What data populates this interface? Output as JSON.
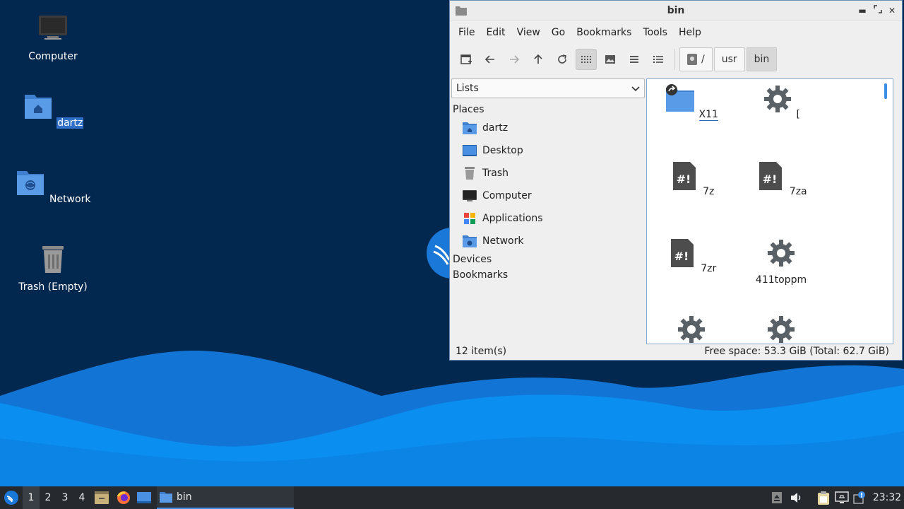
{
  "desktop": {
    "icons": [
      {
        "label": "Computer"
      },
      {
        "label": "dartz"
      },
      {
        "label": "Network"
      },
      {
        "label": "Trash (Empty)"
      }
    ]
  },
  "window": {
    "title": "bin",
    "menus": [
      "File",
      "Edit",
      "View",
      "Go",
      "Bookmarks",
      "Tools",
      "Help"
    ],
    "path": [
      "/",
      "usr",
      "bin"
    ],
    "side_mode": "Lists",
    "places_heading": "Places",
    "places": [
      {
        "label": "dartz",
        "icon": "home-folder-icon"
      },
      {
        "label": "Desktop",
        "icon": "desktop-icon"
      },
      {
        "label": "Trash",
        "icon": "trash-icon"
      },
      {
        "label": "Computer",
        "icon": "computer-icon"
      },
      {
        "label": "Applications",
        "icon": "applications-icon"
      },
      {
        "label": "Network",
        "icon": "network-folder-icon"
      }
    ],
    "devices_heading": "Devices",
    "bookmarks_heading": "Bookmarks",
    "files": [
      {
        "name": "X11",
        "kind": "folder-link"
      },
      {
        "name": "[",
        "kind": "executable"
      },
      {
        "name": "7z",
        "kind": "script"
      },
      {
        "name": "7za",
        "kind": "script"
      },
      {
        "name": "7zr",
        "kind": "script"
      },
      {
        "name": "411toppm",
        "kind": "executable"
      },
      {
        "name": "",
        "kind": "executable"
      },
      {
        "name": "",
        "kind": "executable"
      }
    ],
    "status_count": "12 item(s)",
    "status_space": "Free space: 53.3 GiB (Total: 62.7 GiB)"
  },
  "taskbar": {
    "workspaces": [
      "1",
      "2",
      "3",
      "4"
    ],
    "active_workspace": "1",
    "task_label": "bin",
    "clock": "23:32"
  },
  "colors": {
    "accent": "#3d8ee6",
    "desktop_bg": "#03284f",
    "folder_blue": "#4a90e2"
  }
}
